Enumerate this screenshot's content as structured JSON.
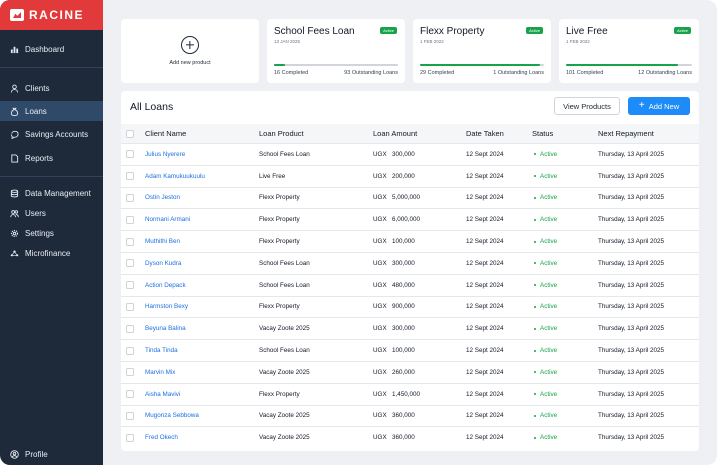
{
  "brand": {
    "name": "RACINE"
  },
  "sidebar": {
    "items": [
      {
        "label": "Dashboard",
        "icon": "bar-chart-icon"
      },
      {
        "label": "Clients",
        "icon": "person-icon"
      },
      {
        "label": "Loans",
        "icon": "money-bag-icon",
        "active": true
      },
      {
        "label": "Savings Accounts",
        "icon": "savings-icon"
      },
      {
        "label": "Reports",
        "icon": "document-icon"
      },
      {
        "label": "Data Management",
        "icon": "database-icon"
      },
      {
        "label": "Users",
        "icon": "users-icon"
      },
      {
        "label": "Settings",
        "icon": "gear-icon"
      },
      {
        "label": "Microfinance",
        "icon": "network-icon"
      }
    ],
    "profile": {
      "label": "Profile",
      "icon": "profile-icon"
    }
  },
  "add_product": {
    "label": "Add new product",
    "icon": "plus-circle-icon"
  },
  "products": [
    {
      "title": "School Fees Loan",
      "date": "13 JAN 2025",
      "badge": "Active",
      "progress": 0.09,
      "completed": "16 Completed",
      "outstanding": "93 Outstanding Loans",
      "bar_color": "#16a34a"
    },
    {
      "title": "Flexx Property",
      "date": "1 FEB 2022",
      "badge": "Active",
      "progress": 0.97,
      "completed": "29 Completed",
      "outstanding": "1 Outstanding Loans",
      "bar_color": "#16a34a"
    },
    {
      "title": "Live Free",
      "date": "1 FEB 2022",
      "badge": "Active",
      "progress": 0.89,
      "completed": "101 Completed",
      "outstanding": "12 Outstanding Loans",
      "bar_color": "#16a34a"
    }
  ],
  "loans": {
    "title": "All Loans",
    "view_products_label": "View Products",
    "add_new_label": "Add New",
    "columns": [
      "Client Name",
      "Loan Product",
      "Loan Amount",
      "Date Taken",
      "Status",
      "Next Repayment"
    ],
    "rows": [
      {
        "name": "Julius Nyerere",
        "product": "School Fees Loan",
        "currency": "UGX",
        "amount": "300,000",
        "date": "12 Sept 2024",
        "status": "Active",
        "next": "Thursday, 13 April 2025"
      },
      {
        "name": "Adam Kamukuukuulu",
        "product": "Live Free",
        "currency": "UGX",
        "amount": "200,000",
        "date": "12 Sept 2024",
        "status": "Active",
        "next": "Thursday, 13 April 2025"
      },
      {
        "name": "Ostin Jeston",
        "product": "Flexx Property",
        "currency": "UGX",
        "amount": "5,000,000",
        "date": "12 Sept 2024",
        "status": "Active",
        "next": "Thursday, 13 April 2025"
      },
      {
        "name": "Normani Armani",
        "product": "Flexx Property",
        "currency": "UGX",
        "amount": "6,000,000",
        "date": "12 Sept 2024",
        "status": "Active",
        "next": "Thursday, 13 April 2025"
      },
      {
        "name": "Muthithi Ben",
        "product": "Flexx Property",
        "currency": "UGX",
        "amount": "100,000",
        "date": "12 Sept 2024",
        "status": "Active",
        "next": "Thursday, 13 April 2025"
      },
      {
        "name": "Dyson Kudra",
        "product": "School Fees Loan",
        "currency": "UGX",
        "amount": "300,000",
        "date": "12 Sept 2024",
        "status": "Active",
        "next": "Thursday, 13 April 2025"
      },
      {
        "name": "Action Depack",
        "product": "School Fees Loan",
        "currency": "UGX",
        "amount": "480,000",
        "date": "12 Sept 2024",
        "status": "Active",
        "next": "Thursday, 13 April 2025"
      },
      {
        "name": "Harmston Bexy",
        "product": "Flexx Property",
        "currency": "UGX",
        "amount": "900,000",
        "date": "12 Sept 2024",
        "status": "Active",
        "next": "Thursday, 13 April 2025"
      },
      {
        "name": "Beyuna Balina",
        "product": "Vacay Zoote 2025",
        "currency": "UGX",
        "amount": "300,000",
        "date": "12 Sept 2024",
        "status": "Active",
        "next": "Thursday, 13 April 2025"
      },
      {
        "name": "Tinda Tinda",
        "product": "School Fees Loan",
        "currency": "UGX",
        "amount": "100,000",
        "date": "12 Sept 2024",
        "status": "Active",
        "next": "Thursday, 13 April 2025"
      },
      {
        "name": "Marvin Mix",
        "product": "Vacay Zoote 2025",
        "currency": "UGX",
        "amount": "260,000",
        "date": "12 Sept 2024",
        "status": "Active",
        "next": "Thursday, 13 April 2025"
      },
      {
        "name": "Aisha Mavivi",
        "product": "Flexx Property",
        "currency": "UGX",
        "amount": "1,450,000",
        "date": "12 Sept 2024",
        "status": "Active",
        "next": "Thursday, 13 April 2025"
      },
      {
        "name": "Mugonza Sebbowa",
        "product": "Vacay Zoote 2025",
        "currency": "UGX",
        "amount": "360,000",
        "date": "12 Sept 2024",
        "status": "Active",
        "next": "Thursday, 13 April 2025"
      },
      {
        "name": "Fred Okech",
        "product": "Vacay Zoote 2025",
        "currency": "UGX",
        "amount": "360,000",
        "date": "12 Sept 2024",
        "status": "Active",
        "next": "Thursday, 13 April 2025"
      }
    ]
  }
}
